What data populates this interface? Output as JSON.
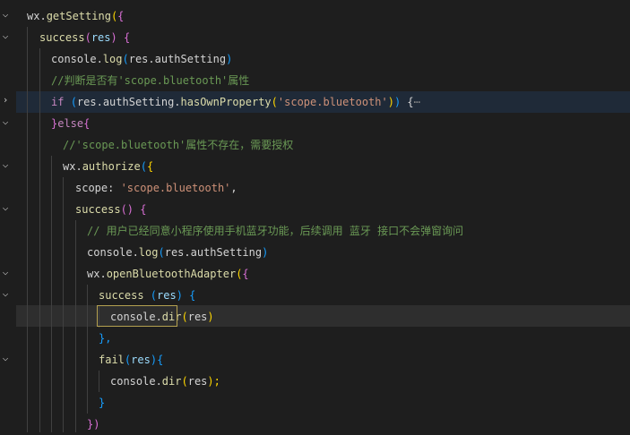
{
  "editor": {
    "lines": [
      {
        "seg": [
          [
            "wx.",
            "wx"
          ],
          [
            "getSetting",
            "fn"
          ],
          [
            "(",
            "y"
          ],
          [
            "{",
            "p"
          ]
        ]
      },
      {
        "seg": [
          [
            "success",
            "fn"
          ],
          [
            "(",
            "p"
          ],
          [
            "res",
            "var"
          ],
          [
            ") ",
            "p"
          ],
          [
            "{",
            "p"
          ]
        ]
      },
      {
        "seg": [
          [
            "console.",
            "plain"
          ],
          [
            "log",
            "fn"
          ],
          [
            "(",
            "b"
          ],
          [
            "res.authSetting",
            "plain"
          ],
          [
            ")",
            "b"
          ]
        ]
      },
      {
        "seg": [
          [
            "//判断是否有'scope.bluetooth'属性",
            "cm"
          ]
        ]
      },
      {
        "seg": [
          [
            "if ",
            "kw"
          ],
          [
            "(",
            "b"
          ],
          [
            "res.authSetting.",
            "plain"
          ],
          [
            "hasOwnProperty",
            "fn"
          ],
          [
            "(",
            "y"
          ],
          [
            "'scope.bluetooth'",
            "str"
          ],
          [
            ")",
            "y"
          ],
          [
            ")",
            "b"
          ],
          [
            " {",
            "plain"
          ],
          [
            "⋯",
            "ellipsis"
          ]
        ]
      },
      {
        "seg": [
          [
            "}",
            "p"
          ],
          [
            "else",
            "kw"
          ],
          [
            "{",
            "p"
          ]
        ]
      },
      {
        "seg": [
          [
            "//'scope.bluetooth'属性不存在，需要授权",
            "cm"
          ]
        ]
      },
      {
        "seg": [
          [
            "wx.",
            "wx"
          ],
          [
            "authorize",
            "fn"
          ],
          [
            "(",
            "b"
          ],
          [
            "{",
            "y"
          ]
        ]
      },
      {
        "seg": [
          [
            "scope: ",
            "plain"
          ],
          [
            "'scope.bluetooth'",
            "str"
          ],
          [
            ",",
            "plain"
          ]
        ]
      },
      {
        "seg": [
          [
            "success",
            "fn"
          ],
          [
            "() ",
            "p"
          ],
          [
            "{",
            "p"
          ]
        ]
      },
      {
        "seg": [
          [
            "// 用户已经同意小程序使用手机蓝牙功能，后续调用 蓝牙 接口不会弹窗询问",
            "cm"
          ]
        ]
      },
      {
        "seg": [
          [
            "console.",
            "plain"
          ],
          [
            "log",
            "fn"
          ],
          [
            "(",
            "b"
          ],
          [
            "res.authSetting",
            "plain"
          ],
          [
            ")",
            "b"
          ]
        ]
      },
      {
        "seg": [
          [
            "wx.",
            "wx"
          ],
          [
            "openBluetoothAdapter",
            "fn"
          ],
          [
            "(",
            "y"
          ],
          [
            "{",
            "p"
          ]
        ]
      },
      {
        "seg": [
          [
            "success ",
            "fn"
          ],
          [
            "(",
            "b"
          ],
          [
            "res",
            "var"
          ],
          [
            ") ",
            "b"
          ],
          [
            "{",
            "b"
          ]
        ]
      },
      {
        "seg": [
          [
            "console.",
            "plain"
          ],
          [
            "dir",
            "fn"
          ],
          [
            "(",
            "y"
          ],
          [
            "res",
            "plain"
          ],
          [
            ")",
            "y"
          ]
        ]
      },
      {
        "seg": [
          [
            "},",
            "b"
          ]
        ]
      },
      {
        "seg": [
          [
            "fail",
            "fn"
          ],
          [
            "(",
            "b"
          ],
          [
            "res",
            "var"
          ],
          [
            ")",
            "b"
          ],
          [
            "{",
            "b"
          ]
        ]
      },
      {
        "seg": [
          [
            "console.",
            "plain"
          ],
          [
            "dir",
            "fn"
          ],
          [
            "(",
            "y"
          ],
          [
            "res",
            "plain"
          ],
          [
            ");",
            "y"
          ]
        ]
      },
      {
        "seg": [
          [
            "}",
            "b"
          ]
        ]
      },
      {
        "seg": [
          [
            "})",
            "p"
          ]
        ]
      }
    ]
  }
}
